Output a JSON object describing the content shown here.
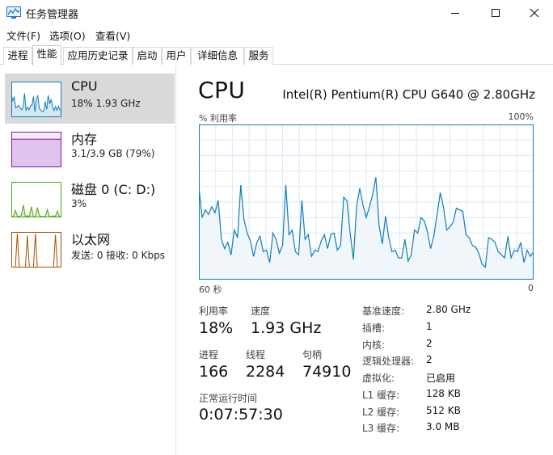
{
  "window": {
    "title": "任务管理器"
  },
  "menu": [
    "文件(F)",
    "选项(O)",
    "查看(V)"
  ],
  "tabs": [
    "进程",
    "性能",
    "应用历史记录",
    "启动",
    "用户",
    "详细信息",
    "服务"
  ],
  "active_tab": "性能",
  "resources": [
    {
      "name": "CPU",
      "sub": "18% 1.93 GHz",
      "color": "#117dbb",
      "selected": true
    },
    {
      "name": "内存",
      "sub": "3.1/3.9 GB (79%)",
      "color": "#8b12ae"
    },
    {
      "name": "磁盘 0 (C: D:)",
      "sub": "3%",
      "color": "#4da60c"
    },
    {
      "name": "以太网",
      "sub": "发送: 0 接收: 0 Kbps",
      "color": "#a74f01"
    }
  ],
  "cpu": {
    "title": "CPU",
    "model": "Intel(R) Pentium(R) CPU G640 @ 2.80GHz",
    "graph_label": "% 利用率",
    "graph_max": "100%",
    "time_left": "60 秒",
    "time_right": "0",
    "stats": {
      "utilization_label": "利用率",
      "utilization": "18%",
      "speed_label": "速度",
      "speed": "1.93 GHz",
      "processes_label": "进程",
      "processes": "166",
      "threads_label": "线程",
      "threads": "2284",
      "handles_label": "句柄",
      "handles": "74910",
      "uptime_label": "正常运行时间",
      "uptime": "0:07:57:30"
    },
    "info": [
      {
        "label": "基准速度:",
        "value": "2.80 GHz"
      },
      {
        "label": "插槽:",
        "value": "1"
      },
      {
        "label": "内核:",
        "value": "2"
      },
      {
        "label": "逻辑处理器:",
        "value": "2"
      },
      {
        "label": "虚拟化:",
        "value": "已启用"
      },
      {
        "label": "L1 缓存:",
        "value": "128 KB"
      },
      {
        "label": "L2 缓存:",
        "value": "512 KB"
      },
      {
        "label": "L3 缓存:",
        "value": "3.0 MB"
      }
    ],
    "series": [
      60,
      40,
      45,
      42,
      47,
      43,
      51,
      26,
      20,
      24,
      16,
      32,
      27,
      61,
      39,
      30,
      25,
      15,
      24,
      28,
      18,
      19,
      11,
      30,
      26,
      17,
      22,
      61,
      29,
      32,
      18,
      16,
      51,
      26,
      29,
      15,
      19,
      18,
      25,
      29,
      20,
      29,
      30,
      19,
      22,
      53,
      51,
      30,
      13,
      47,
      59,
      48,
      40,
      47,
      55,
      66,
      35,
      23,
      41,
      27,
      18,
      19,
      14,
      14,
      26,
      12,
      16,
      32,
      30,
      40,
      38,
      31,
      20,
      28,
      42,
      56,
      47,
      32,
      34,
      37,
      46,
      45,
      44,
      29,
      27,
      22,
      21,
      17,
      10,
      8,
      27,
      26,
      24,
      18,
      16,
      14,
      28,
      14,
      19,
      18,
      24,
      11,
      19,
      15,
      18
    ]
  }
}
